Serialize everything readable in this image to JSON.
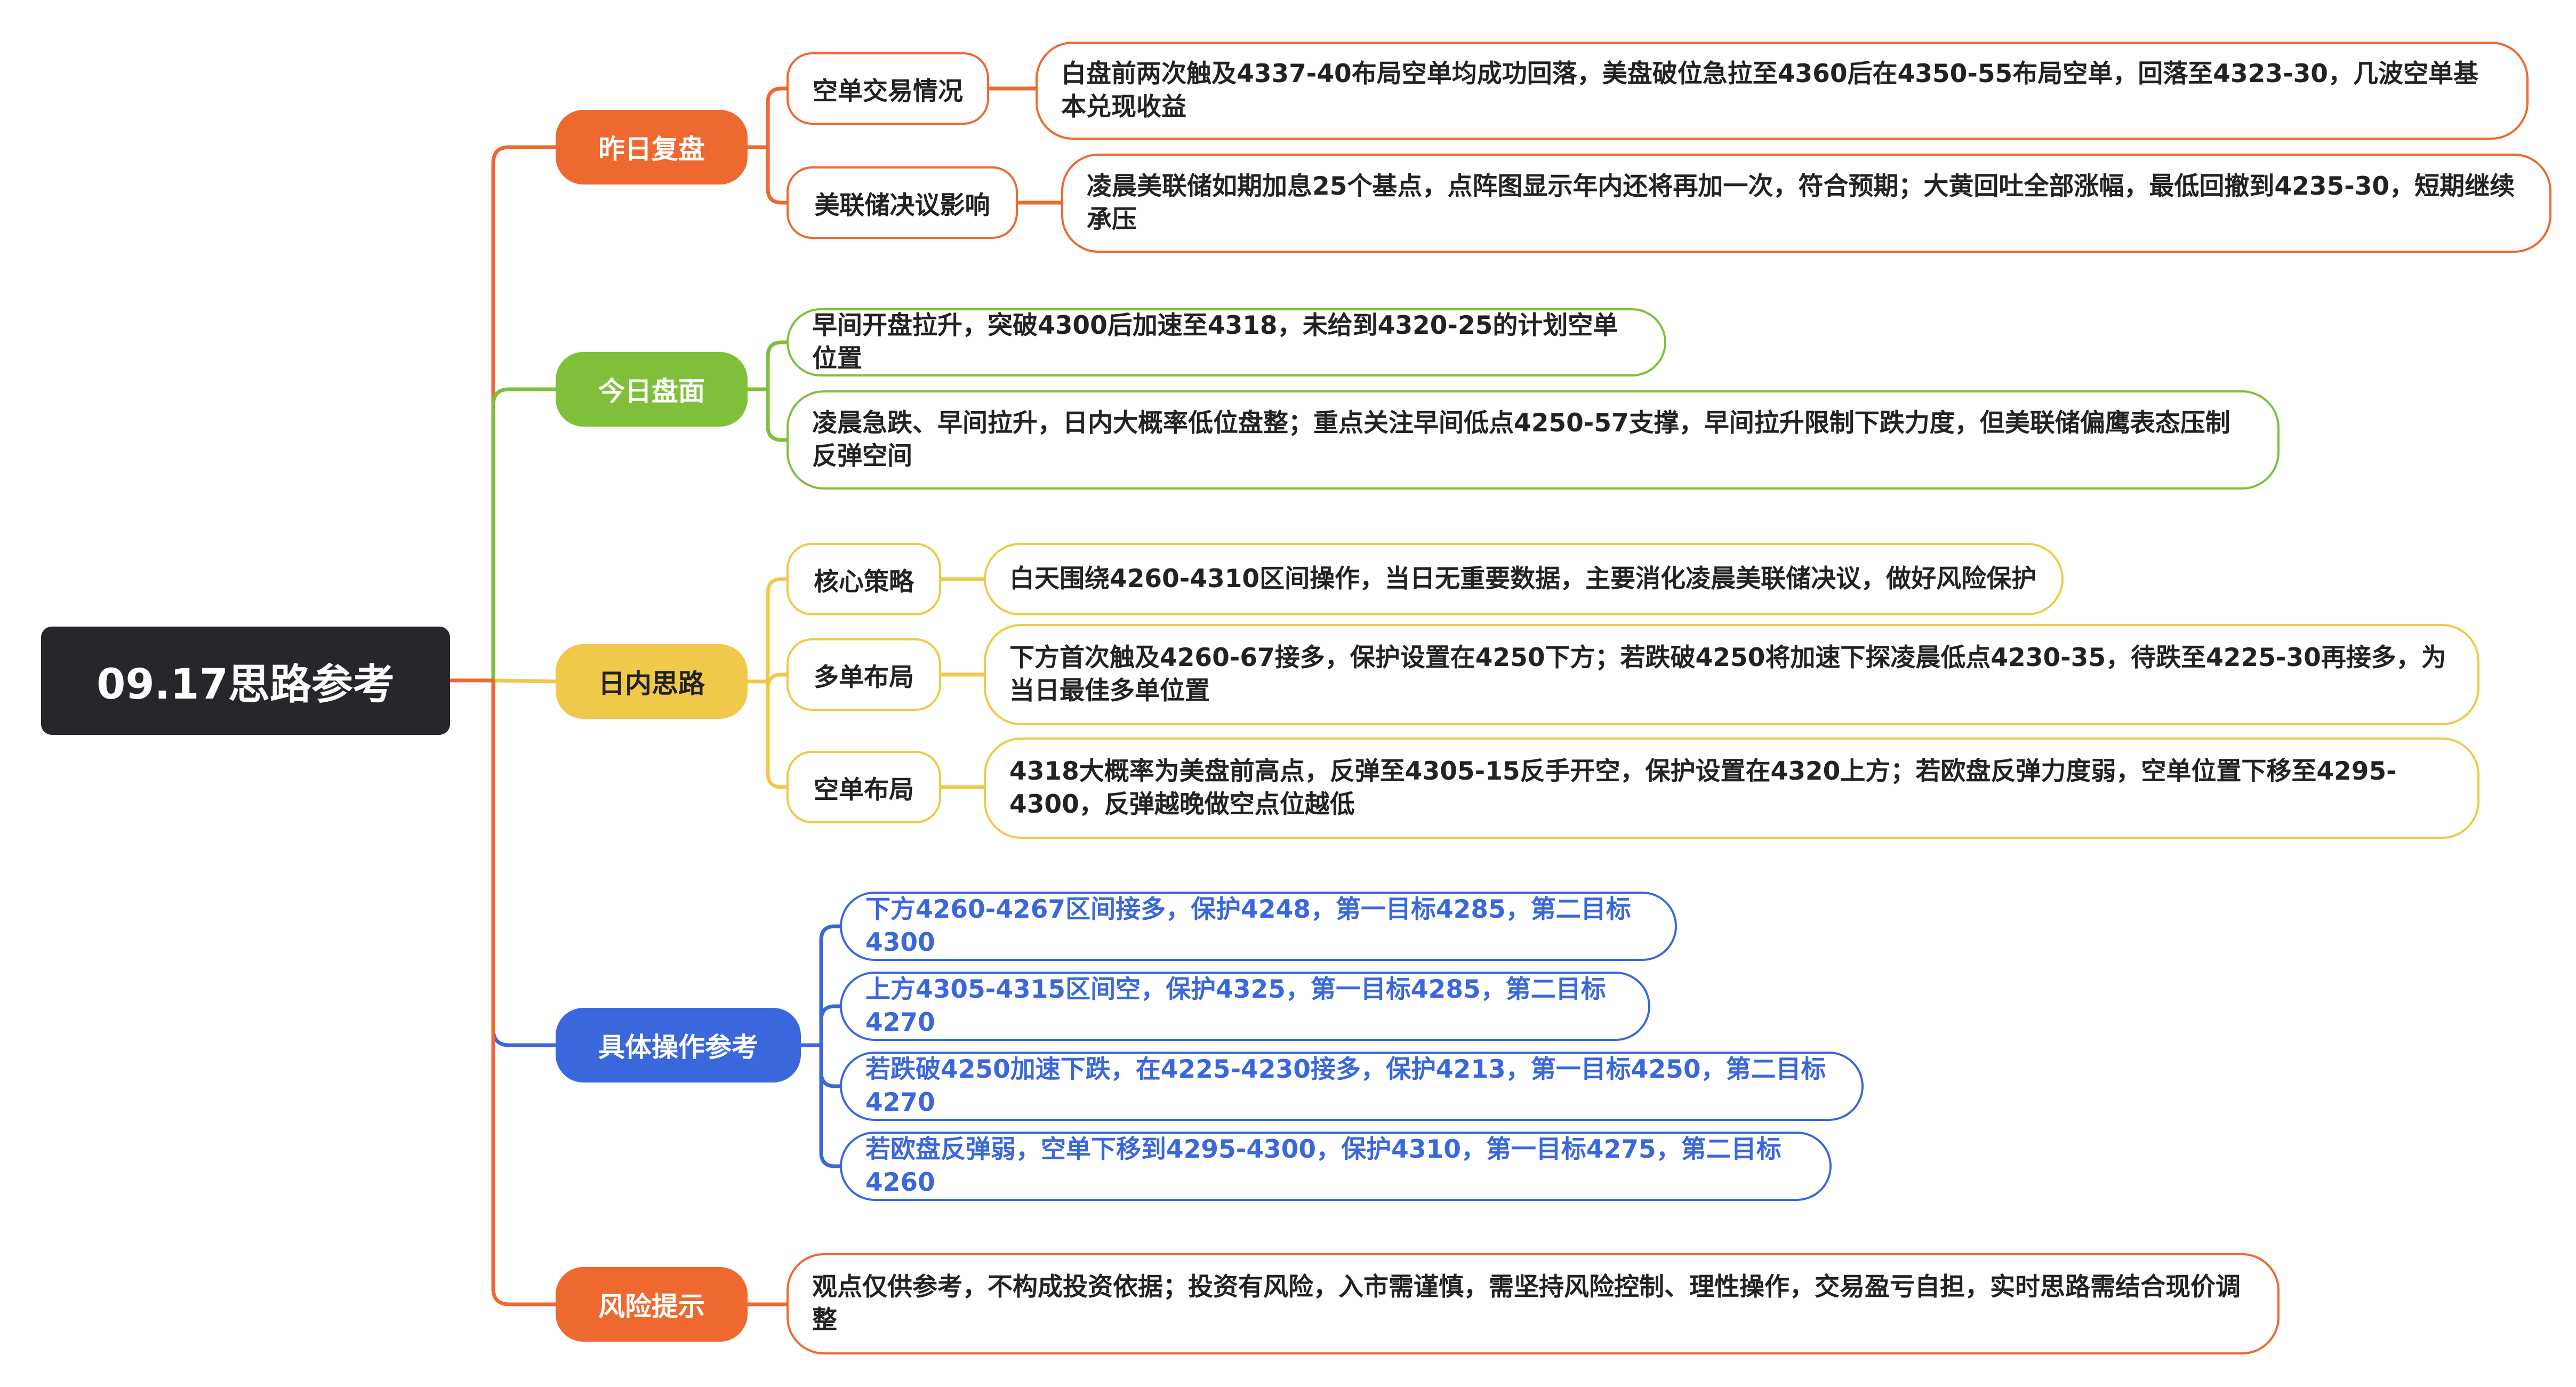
{
  "title": "09.17思路参考",
  "colors": {
    "root": "#26272b",
    "orange": "#ee6930",
    "green": "#7fbf3a",
    "yellow": "#f0c94a",
    "blue": "#3a67db"
  },
  "branches": [
    {
      "label": "昨日复盘",
      "color": "orange",
      "subtopics": [
        {
          "label": "空单交易情况",
          "detail": "白盘前两次触及4337-40布局空单均成功回落，美盘破位急拉至4360后在4350-55布局空单，回落至4323-30，几波空单基本兑现收益"
        },
        {
          "label": "美联储决议影响",
          "detail": "凌晨美联储如期加息25个基点，点阵图显示年内还将再加一次，符合预期；大黄回吐全部涨幅，最低回撤到4235-30，短期继续承压"
        }
      ]
    },
    {
      "label": "今日盘面",
      "color": "green",
      "items": [
        "早间开盘拉升，突破4300后加速至4318，未给到4320-25的计划空单位置",
        "凌晨急跌、早间拉升，日内大概率低位盘整；重点关注早间低点4250-57支撑，早间拉升限制下跌力度，但美联储偏鹰表态压制反弹空间"
      ]
    },
    {
      "label": "日内思路",
      "color": "yellow",
      "subtopics": [
        {
          "label": "核心策略",
          "detail": "白天围绕4260-4310区间操作，当日无重要数据，主要消化凌晨美联储决议，做好风险保护"
        },
        {
          "label": "多单布局",
          "detail": "下方首次触及4260-67接多，保护设置在4250下方；若跌破4250将加速下探凌晨低点4230-35，待跌至4225-30再接多，为当日最佳多单位置"
        },
        {
          "label": "空单布局",
          "detail": "4318大概率为美盘前高点，反弹至4305-15反手开空，保护设置在4320上方；若欧盘反弹力度弱，空单位置下移至4295-4300，反弹越晚做空点位越低"
        }
      ]
    },
    {
      "label": "具体操作参考",
      "color": "blue",
      "items": [
        "下方4260-4267区间接多，保护4248，第一目标4285，第二目标4300",
        "上方4305-4315区间空，保护4325，第一目标4285，第二目标4270",
        "若跌破4250加速下跌，在4225-4230接多，保护4213，第一目标4250，第二目标4270",
        "若欧盘反弹弱，空单下移到4295-4300，保护4310，第一目标4275，第二目标4260"
      ]
    },
    {
      "label": "风险提示",
      "color": "orange",
      "items": [
        "观点仅供参考，不构成投资依据；投资有风险，入市需谨慎，需坚持风险控制、理性操作，交易盈亏自担，实时思路需结合现价调整"
      ]
    }
  ]
}
